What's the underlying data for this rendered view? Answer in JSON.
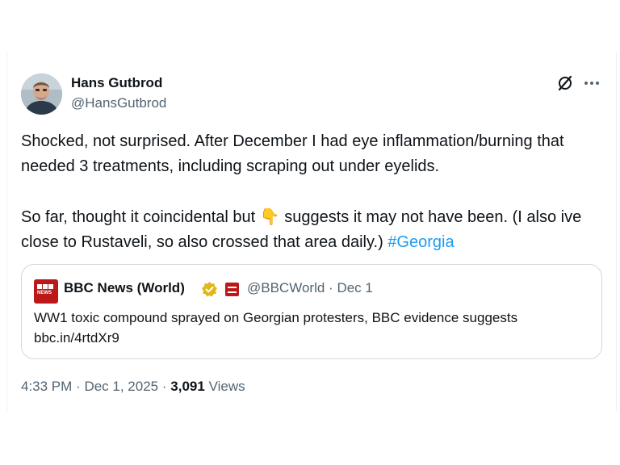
{
  "author": {
    "name": "Hans Gutbrod",
    "handle": "@HansGutbrod",
    "avatar_icon": "avatar-photo"
  },
  "actions": {
    "grok_icon": "grok-icon",
    "more_icon": "more-dots-icon"
  },
  "tweet": {
    "line1": "Shocked, not surprised. After December I had eye inflammation/burning that needed 3 treatments, including scraping out under eyelids.",
    "line2_before": "So far, thought it coincidental but ",
    "emoji": "👇",
    "line2_after": " suggests it may not have been. (I also ive close to Rustaveli, so also crossed that area daily.) ",
    "hashtag": "#Georgia"
  },
  "quote": {
    "name": "BBC News (World)",
    "handle": "@BBCWorld",
    "separator": "·",
    "date": "Dec 1",
    "text": "WW1 toxic compound sprayed on Georgian protesters, BBC evidence suggests",
    "link": "bbc.in/4rtdXr9",
    "logo_text": "NEWS",
    "verified_color": "#e2b719",
    "brand_color": "#bb1919"
  },
  "footer": {
    "time": "4:33 PM",
    "separator": "·",
    "date": "Dec 1, 2025",
    "views_count": "3,091",
    "views_label": "Views"
  },
  "colors": {
    "text": "#0f1419",
    "secondary": "#536471",
    "link": "#1d9bf0",
    "border": "#cfd9de"
  }
}
